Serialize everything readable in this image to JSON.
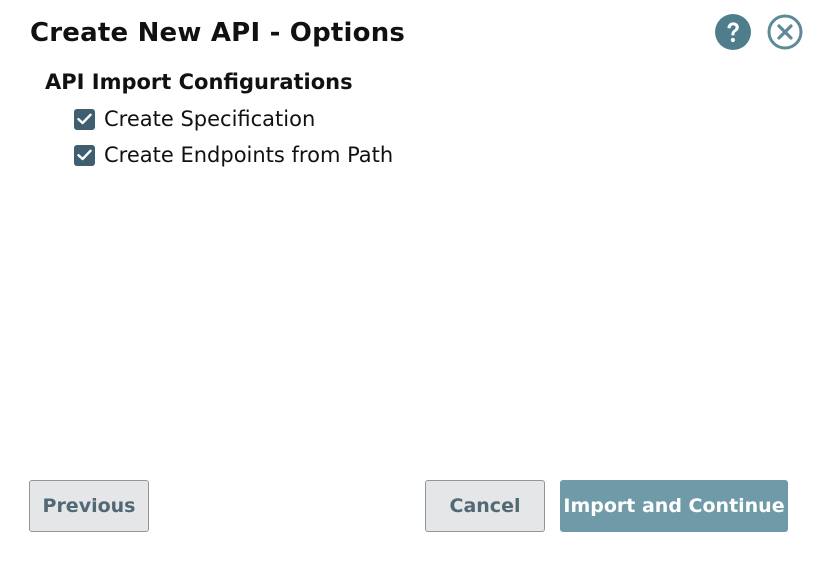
{
  "dialog": {
    "title": "Create New API - Options",
    "help_icon": "help-circle-icon",
    "close_icon": "close-circle-icon"
  },
  "section": {
    "title": "API Import Configurations",
    "options": [
      {
        "label": "Create Specification",
        "checked": true
      },
      {
        "label": "Create Endpoints from Path",
        "checked": true
      }
    ]
  },
  "footer": {
    "previous_label": "Previous",
    "cancel_label": "Cancel",
    "primary_label": "Import and Continue"
  },
  "colors": {
    "accent": "#6f9aa8",
    "checkbox": "#3f5e6f",
    "help_icon": "#4e7d8c",
    "close_icon": "#5e8a98",
    "secondary_text": "#526874"
  }
}
